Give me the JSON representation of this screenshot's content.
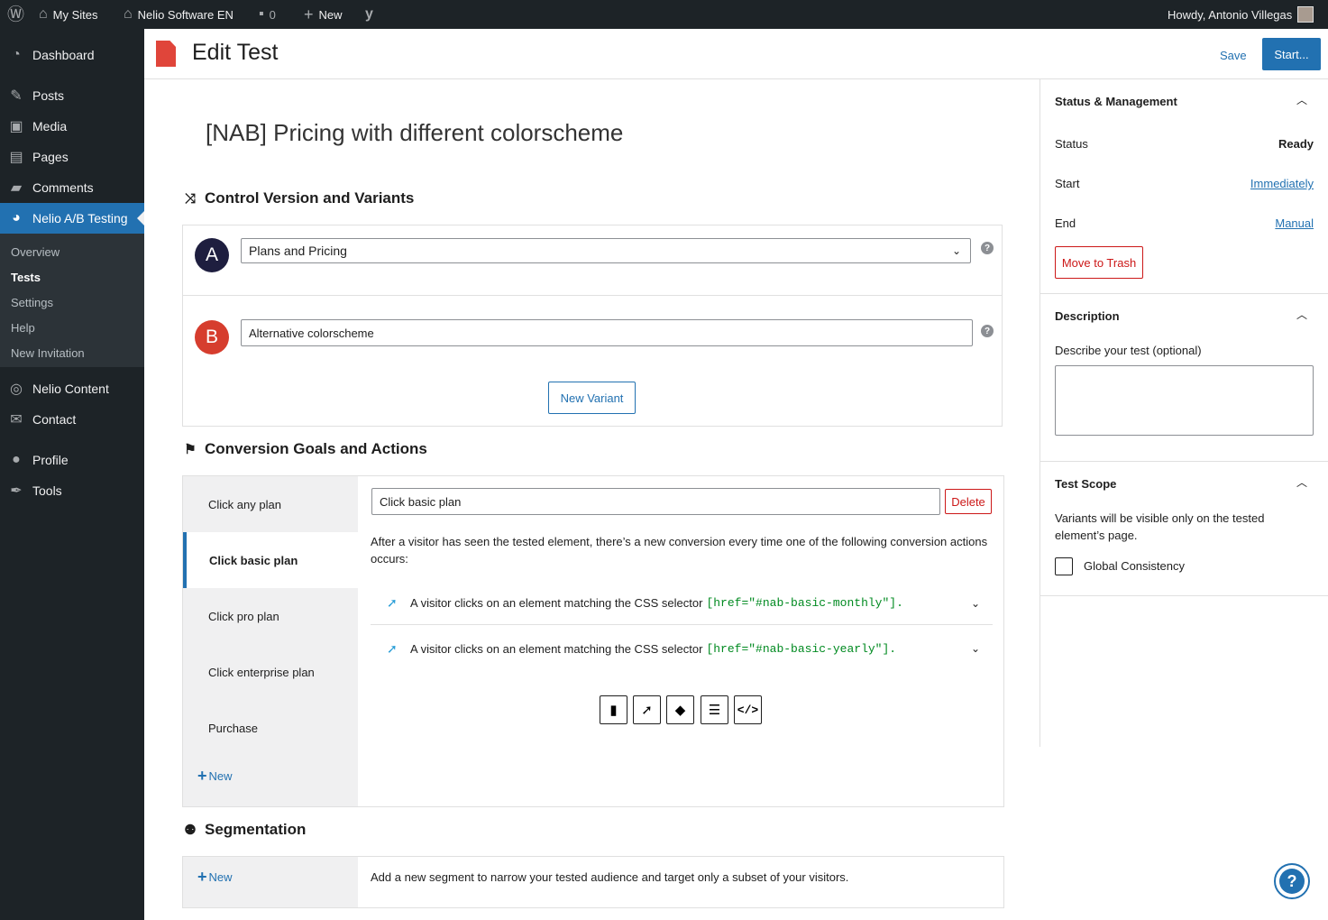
{
  "adminbar": {
    "my_sites": "My Sites",
    "site_name": "Nelio Software EN",
    "comments_count": "0",
    "new": "New",
    "howdy": "Howdy, Antonio Villegas"
  },
  "sidebar": {
    "items": [
      {
        "label": "Dashboard",
        "icon": "dashboard-icon"
      },
      {
        "label": "Posts",
        "icon": "pin-icon"
      },
      {
        "label": "Media",
        "icon": "media-icon"
      },
      {
        "label": "Pages",
        "icon": "pages-icon"
      },
      {
        "label": "Comments",
        "icon": "comment-icon"
      },
      {
        "label": "Nelio A/B Testing",
        "icon": "nelio-icon"
      },
      {
        "label": "Nelio Content",
        "icon": "nelio-content-icon"
      },
      {
        "label": "Contact",
        "icon": "mail-icon"
      },
      {
        "label": "Profile",
        "icon": "user-icon"
      },
      {
        "label": "Tools",
        "icon": "wrench-icon"
      }
    ],
    "submenu": [
      "Overview",
      "Tests",
      "Settings",
      "Help",
      "New Invitation"
    ]
  },
  "header": {
    "title": "Edit Test",
    "save": "Save",
    "start": "Start..."
  },
  "test": {
    "name": "[NAB] Pricing with different colorscheme"
  },
  "variants_section": {
    "heading": "Control Version and Variants",
    "a_letter": "A",
    "a_value": "Plans and Pricing",
    "b_letter": "B",
    "b_value": "Alternative colorscheme",
    "new_variant": "New Variant"
  },
  "goals_section": {
    "heading": "Conversion Goals and Actions",
    "goals": [
      "Click any plan",
      "Click basic plan",
      "Click pro plan",
      "Click enterprise plan",
      "Purchase"
    ],
    "new": "New",
    "selected_goal_name": "Click basic plan",
    "delete": "Delete",
    "explanation": "After a visitor has seen the tested element, there’s a new conversion every time one of the following conversion actions occurs:",
    "actions": [
      {
        "text": "A visitor clicks on an element matching the CSS selector",
        "selector": "[href=\"#nab-basic-monthly\"]."
      },
      {
        "text": "A visitor clicks on an element matching the CSS selector",
        "selector": "[href=\"#nab-basic-yearly\"]."
      }
    ]
  },
  "segmentation_section": {
    "heading": "Segmentation",
    "new": "New",
    "description": "Add a new segment to narrow your tested audience and target only a subset of your visitors."
  },
  "panel": {
    "status_management": "Status & Management",
    "status_label": "Status",
    "status_value": "Ready",
    "start_label": "Start",
    "start_value": "Immediately",
    "end_label": "End",
    "end_value": "Manual",
    "trash": "Move to Trash",
    "description_heading": "Description",
    "description_label": "Describe your test (optional)",
    "scope_heading": "Test Scope",
    "scope_text": "Variants will be visible only on the tested element’s page.",
    "global_consistency": "Global Consistency"
  },
  "colors": {
    "accent": "#2271b1",
    "variant_a": "#1e1e3f",
    "variant_b": "#d63d2e",
    "danger": "#cc1818",
    "admin_bg": "#1d2327"
  }
}
